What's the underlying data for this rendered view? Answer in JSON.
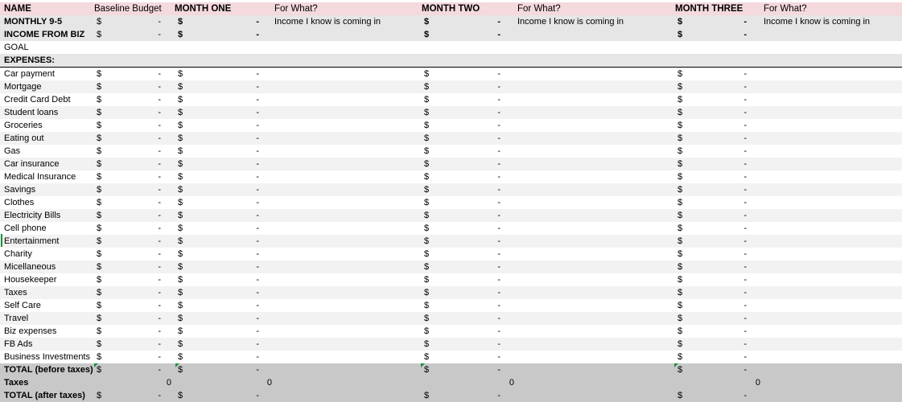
{
  "header": {
    "name": "NAME",
    "baseline": "Baseline Budget",
    "month_one": "MONTH ONE",
    "for_what_1": "For What?",
    "month_two": "MONTH TWO",
    "for_what_2": "For What?",
    "month_three": "MONTH THREE",
    "for_what_3": "For What?"
  },
  "symbols": {
    "dollar": "$",
    "dash": "-"
  },
  "income": [
    {
      "label": "MONTHLY 9-5",
      "note": "Income I know is coming in"
    },
    {
      "label": "INCOME FROM BIZ",
      "note": ""
    }
  ],
  "goal_label": "GOAL",
  "expenses_label": "EXPENSES:",
  "expenses": [
    "Car payment",
    "Mortgage",
    "Credit Card Debt",
    "Student loans",
    "Groceries",
    "Eating out",
    "Gas",
    "Car insurance",
    "Medical Insurance",
    "Savings",
    "Clothes",
    "Electricity Bills",
    "Cell phone",
    "Entertainment",
    "Charity",
    "Micellaneous",
    "Housekeeper",
    "Taxes",
    "Self Care",
    "Travel",
    "Biz expenses",
    "FB Ads",
    "Business Investments"
  ],
  "totals": {
    "before_label": "TOTAL (before taxes)",
    "taxes_label": "Taxes",
    "after_label": "TOTAL (after taxes)",
    "taxes_value": "0"
  },
  "colors": {
    "header_bg": "#f4d9dd",
    "income_bg": "#e6e6e6",
    "stripe_bg": "#f2f2f2",
    "total_bg": "#c8c8c8",
    "selection_marker": "#1e8e3e"
  }
}
